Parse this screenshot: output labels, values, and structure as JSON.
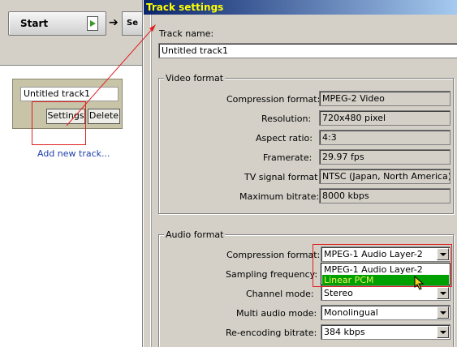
{
  "left_app": {
    "start_label": "Start",
    "next_label": "Se",
    "track": {
      "name": "Untitled track1",
      "settings_label": "Settings",
      "delete_label": "Delete"
    },
    "add_track_label": "Add new track..."
  },
  "dialog": {
    "title": "Track settings",
    "track_name_label": "Track name:",
    "track_name_value": "Untitled track1",
    "video": {
      "group_title": "Video format",
      "rows": [
        {
          "label": "Compression format:",
          "value": "MPEG-2 Video"
        },
        {
          "label": "Resolution:",
          "value": "720x480 pixel"
        },
        {
          "label": "Aspect ratio:",
          "value": "4:3"
        },
        {
          "label": "Framerate:",
          "value": "29.97 fps"
        },
        {
          "label": "TV signal format",
          "value": "NTSC (Japan, North America)"
        },
        {
          "label": "Maximum bitrate:",
          "value": "8000 kbps"
        }
      ]
    },
    "audio": {
      "group_title": "Audio format",
      "compression_label": "Compression format:",
      "compression_value": "MPEG-1 Audio Layer-2",
      "compression_options": [
        "MPEG-1 Audio Layer-2",
        "Linear PCM"
      ],
      "highlighted_option": "Linear PCM",
      "sampling_label": "Sampling frequency:",
      "channel_label": "Channel mode:",
      "channel_value": "Stereo",
      "multi_label": "Multi audio mode:",
      "multi_value": "Monolingual",
      "reencode_label": "Re-encoding bitrate:",
      "reencode_value": "384 kbps"
    }
  },
  "colors": {
    "highlight_green": "#00a000",
    "annotation_red": "#e02020",
    "title_gradient_start": "#0a246a"
  }
}
